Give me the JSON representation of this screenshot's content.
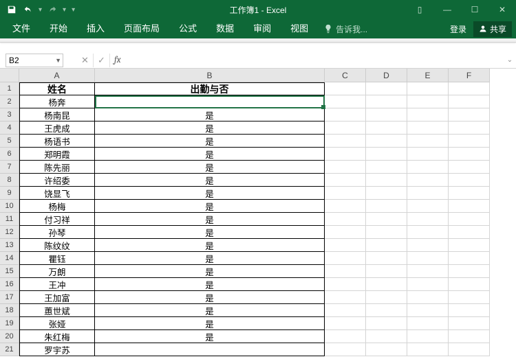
{
  "app": {
    "title": "工作簿1 - Excel"
  },
  "qat": {
    "save": "保存",
    "undo": "撤消",
    "redo": "恢复"
  },
  "win": {
    "ribbon_opts": "▯",
    "min": "—",
    "max": "☐",
    "close": "✕"
  },
  "tabs": {
    "file": "文件",
    "home": "开始",
    "insert": "插入",
    "layout": "页面布局",
    "formulas": "公式",
    "data": "数据",
    "review": "审阅",
    "view": "视图"
  },
  "tellme": "告诉我...",
  "ribbon_right": {
    "login": "登录",
    "share": "共享"
  },
  "namebox": "B2",
  "fx_cancel": "✕",
  "fx_enter": "✓",
  "fx_label": "fx",
  "columns": [
    "A",
    "B",
    "C",
    "D",
    "E",
    "F"
  ],
  "row_numbers": [
    1,
    2,
    3,
    4,
    5,
    6,
    7,
    8,
    9,
    10,
    11,
    12,
    13,
    14,
    15,
    16,
    17,
    18,
    19,
    20,
    21
  ],
  "headers": {
    "name": "姓名",
    "attend": "出勤与否"
  },
  "rows": [
    {
      "name": "杨奔",
      "attend": ""
    },
    {
      "name": "杨南昆",
      "attend": "是"
    },
    {
      "name": "王虎成",
      "attend": "是"
    },
    {
      "name": "杨语书",
      "attend": "是"
    },
    {
      "name": "郑明霞",
      "attend": "是"
    },
    {
      "name": "陈先丽",
      "attend": "是"
    },
    {
      "name": "许绍委",
      "attend": "是"
    },
    {
      "name": "饶显飞",
      "attend": "是"
    },
    {
      "name": "杨梅",
      "attend": "是"
    },
    {
      "name": "付习祥",
      "attend": "是"
    },
    {
      "name": "孙琴",
      "attend": "是"
    },
    {
      "name": "陈纹纹",
      "attend": "是"
    },
    {
      "name": "瞿钰",
      "attend": "是"
    },
    {
      "name": "万朗",
      "attend": "是"
    },
    {
      "name": "王冲",
      "attend": "是"
    },
    {
      "name": "王加富",
      "attend": "是"
    },
    {
      "name": "蕙世斌",
      "attend": "是"
    },
    {
      "name": "张娅",
      "attend": "是"
    },
    {
      "name": "朱红梅",
      "attend": "是"
    },
    {
      "name": "罗宇苏",
      "attend": ""
    }
  ]
}
